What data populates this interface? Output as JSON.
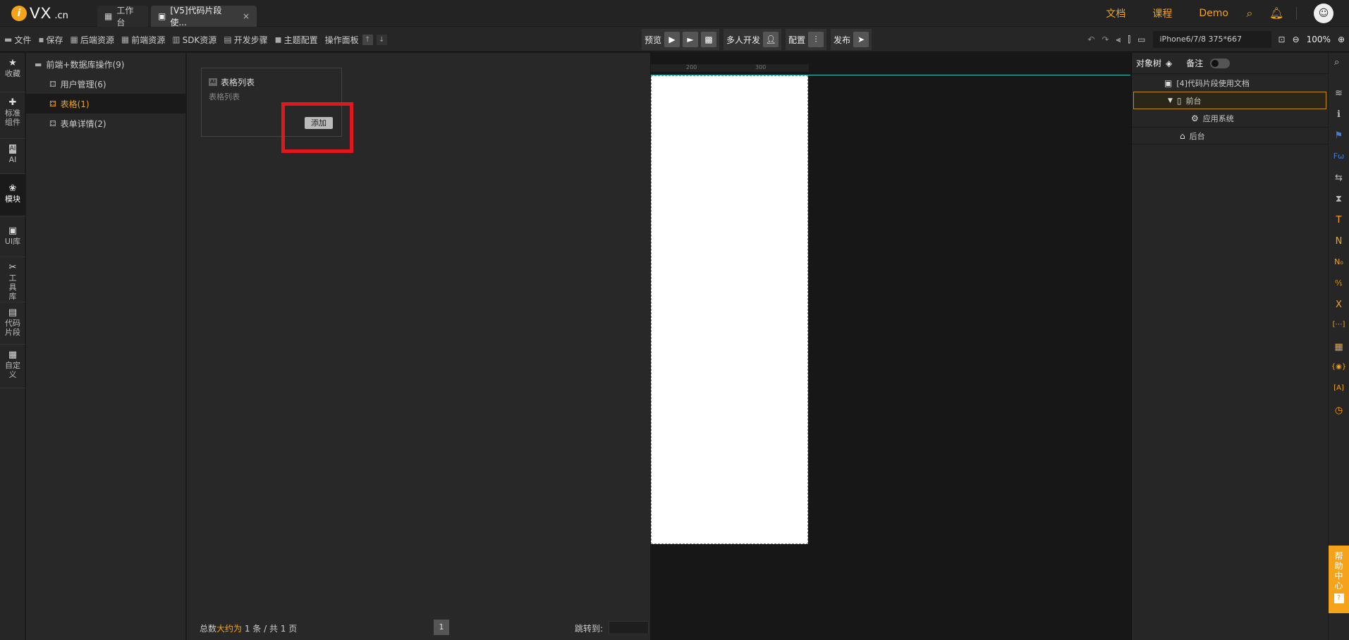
{
  "logo": {
    "i": "i",
    "name": "VX",
    "tld": ".cn"
  },
  "tabs": [
    {
      "label": "工作台",
      "icon": "grid-icon"
    },
    {
      "label": "[V5]代码片段使...",
      "icon": "app-icon",
      "close": "×"
    }
  ],
  "header_links": {
    "docs": "文档",
    "course": "课程",
    "demo": "Demo"
  },
  "toolbar": {
    "file": "文件",
    "save": "保存",
    "backend_res": "后端资源",
    "frontend_res": "前端资源",
    "sdk_res": "SDK资源",
    "dev_steps": "开发步骤",
    "theme": "主题配置",
    "ops_panel": "操作面板",
    "up": "↑",
    "down": "↓",
    "preview": "预览",
    "multi_dev": "多人开发",
    "config": "配置",
    "publish": "发布",
    "device": "iPhone6/7/8 375*667",
    "zoom": "100%"
  },
  "rail": [
    {
      "label": "收藏",
      "icon": "star-icon",
      "glyph": "★"
    },
    {
      "label": "标准组件",
      "icon": "puzzle-icon",
      "glyph": "✚"
    },
    {
      "label": "AI",
      "icon": "ai-icon",
      "glyph": "AI"
    },
    {
      "label": "模块",
      "icon": "modules-icon",
      "glyph": "❀"
    },
    {
      "label": "UI库",
      "icon": "ui-lib-icon",
      "glyph": "▣"
    },
    {
      "label": "工具库",
      "icon": "tools-icon",
      "glyph": "✂"
    },
    {
      "label": "代码片段",
      "icon": "snippet-icon",
      "glyph": "▤"
    },
    {
      "label": "自定义",
      "icon": "custom-icon",
      "glyph": "▦"
    }
  ],
  "tree": {
    "root": "前端+数据库操作(9)",
    "items": [
      "用户管理(6)",
      "表格(1)",
      "表单详情(2)"
    ]
  },
  "card": {
    "badge": "AI",
    "title": "表格列表",
    "desc": "表格列表",
    "add": "添加"
  },
  "pager": {
    "total_prefix": "总数",
    "total_hl": "大约为",
    "total_suffix": " 1 条 / 共 1 页",
    "page": "1",
    "jump": "跳转到:"
  },
  "ruler": {
    "t200": "200",
    "t300": "300"
  },
  "object_tree": {
    "title": "对象树",
    "notes": "备注",
    "doc": "[4]代码片段使用文档",
    "front": "前台",
    "app": "应用系统",
    "back": "后台"
  },
  "right_rail_glyphs": [
    "≋",
    "ℹ",
    "⚑",
    "Fω",
    "⇆",
    "⧗",
    "T",
    "N",
    "N₀",
    "⁰⁄₁",
    "X",
    "[⋯]",
    "▦",
    "{◉}",
    "[A]",
    "◷"
  ],
  "help": {
    "text": "帮助中心",
    "q": "?"
  },
  "colors": {
    "accent": "#f5a31a",
    "highlight": "#e0171c"
  }
}
